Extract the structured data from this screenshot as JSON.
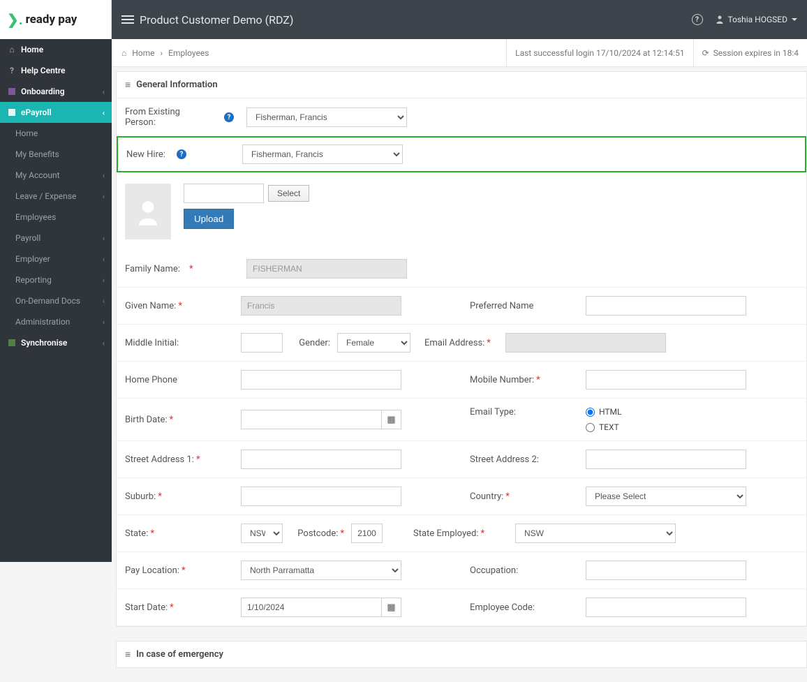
{
  "brand": "ready pay",
  "header": {
    "title": "Product Customer Demo (RDZ)",
    "user": "Toshia HOGSED"
  },
  "breadcrumb": {
    "home": "Home",
    "current": "Employees"
  },
  "statusbar": {
    "lastLogin": "Last successful login 17/10/2024 at 12:14:51",
    "sessionExpires": "Session expires in 18:4"
  },
  "sidebar": {
    "home": "Home",
    "helpCentre": "Help Centre",
    "onboarding": "Onboarding",
    "epayroll": "ePayroll",
    "sub_home": "Home",
    "myBenefits": "My Benefits",
    "myAccount": "My Account",
    "leaveExpense": "Leave / Expense",
    "employees": "Employees",
    "payroll": "Payroll",
    "employer": "Employer",
    "reporting": "Reporting",
    "onDemand": "On-Demand Docs",
    "administration": "Administration",
    "synchronise": "Synchronise"
  },
  "panel": {
    "generalInfo": "General Information",
    "emergency": "In case of emergency"
  },
  "labels": {
    "fromExisting": "From Existing Person:",
    "newHire": "New Hire:",
    "familyName": "Family Name:",
    "givenName": "Given Name:",
    "preferredName": "Preferred Name",
    "middleInitial": "Middle Initial:",
    "gender": "Gender:",
    "emailAddress": "Email Address:",
    "homePhone": "Home Phone",
    "mobile": "Mobile Number:",
    "birthDate": "Birth Date:",
    "emailType": "Email Type:",
    "street1": "Street Address 1:",
    "street2": "Street Address 2:",
    "suburb": "Suburb:",
    "country": "Country:",
    "state": "State:",
    "postcode": "Postcode:",
    "stateEmployed": "State Employed:",
    "payLocation": "Pay Location:",
    "occupation": "Occupation:",
    "startDate": "Start Date:",
    "employeeCode": "Employee Code:"
  },
  "buttons": {
    "select": "Select",
    "upload": "Upload"
  },
  "values": {
    "fromExisting": "Fisherman, Francis",
    "newHire": "Fisherman, Francis",
    "familyName": "FISHERMAN",
    "givenName": "Francis",
    "gender": "Female",
    "state": "NSW",
    "postcode": "2100",
    "stateEmployed": "NSW",
    "payLocation": "North Parramatta",
    "country": "Please Select",
    "startDate": "1/10/2024",
    "emailType_html": "HTML",
    "emailType_text": "TEXT"
  }
}
